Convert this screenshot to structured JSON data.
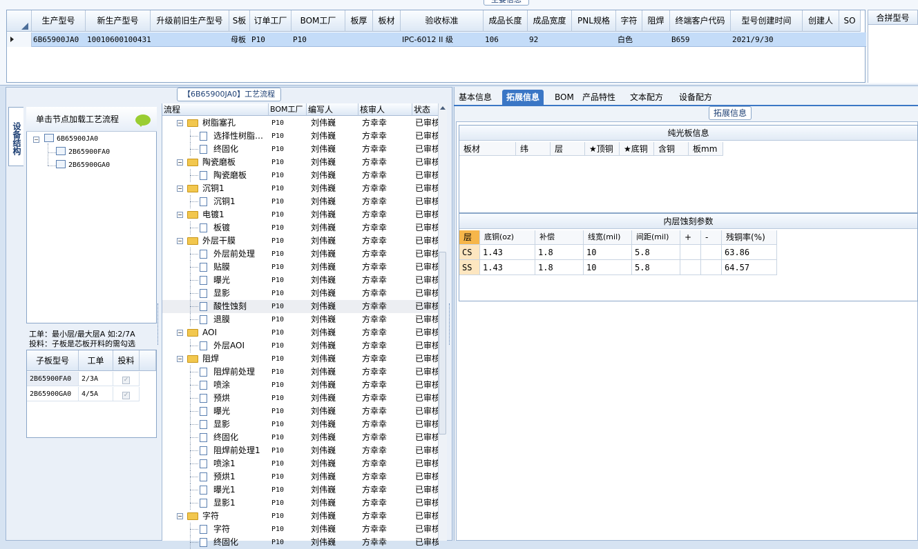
{
  "main_info": {
    "title": "主要信息",
    "columns": [
      "生产型号",
      "新生产型号",
      "升级前旧生产型号",
      "S板",
      "订单工厂",
      "BOM工厂",
      "板厚",
      "板材",
      "验收标准",
      "成品长度",
      "成品宽度",
      "PNL规格",
      "字符",
      "阻焊",
      "终端客户代码",
      "型号创建时间",
      "创建人",
      "SO"
    ],
    "row": {
      "prod_model": "6B65900JA0",
      "new_model": "10010600100431",
      "old_model": "",
      "s_board": "母板",
      "order_factory": "P10",
      "bom_factory": "P10",
      "thickness": "",
      "material": "",
      "standard": "IPC-6012 II 级",
      "length": "106",
      "width": "92",
      "pnl": "",
      "char": "白色",
      "solder": "",
      "client_code": "B659",
      "created": "2021/9/30",
      "creator": "",
      "so": ""
    },
    "merge_header": "合拼型号"
  },
  "process": {
    "title": "【6B65900JA0】工艺流程",
    "side_tab": "设备结构",
    "tree_hint": "单击节点加载工艺流程",
    "tree": {
      "root": "6B65900JA0",
      "children": [
        "2B65900FA0",
        "2B65900GA0"
      ]
    },
    "note1": "工单：最小层/最大层A 如:2/7A",
    "note2": "投料：子板是芯板开料的需勾选",
    "sub_headers": [
      "子板型号",
      "工单",
      "投料"
    ],
    "sub_rows": [
      {
        "model": "2B65900FA0",
        "order": "2/3A",
        "checked": "✓"
      },
      {
        "model": "2B65900GA0",
        "order": "4/5A",
        "checked": "✓"
      }
    ],
    "grid_headers": [
      "流程",
      "BOM工厂",
      "编写人",
      "核审人",
      "状态"
    ],
    "rows": [
      {
        "name": "树脂塞孔",
        "type": "folder",
        "factory": "P10",
        "writer": "刘伟巍",
        "reviewer": "方幸幸",
        "status": "已审核"
      },
      {
        "name": "选择性树脂…",
        "type": "doc",
        "factory": "P10",
        "writer": "刘伟巍",
        "reviewer": "方幸幸",
        "status": "已审核"
      },
      {
        "name": "终固化",
        "type": "doc",
        "factory": "P10",
        "writer": "刘伟巍",
        "reviewer": "方幸幸",
        "status": "已审核"
      },
      {
        "name": "陶瓷磨板",
        "type": "folder",
        "factory": "P10",
        "writer": "刘伟巍",
        "reviewer": "方幸幸",
        "status": "已审核"
      },
      {
        "name": "陶瓷磨板",
        "type": "doc",
        "factory": "P10",
        "writer": "刘伟巍",
        "reviewer": "方幸幸",
        "status": "已审核"
      },
      {
        "name": "沉铜1",
        "type": "folder",
        "factory": "P10",
        "writer": "刘伟巍",
        "reviewer": "方幸幸",
        "status": "已审核"
      },
      {
        "name": "沉铜1",
        "type": "doc",
        "factory": "P10",
        "writer": "刘伟巍",
        "reviewer": "方幸幸",
        "status": "已审核"
      },
      {
        "name": "电镀1",
        "type": "folder",
        "factory": "P10",
        "writer": "刘伟巍",
        "reviewer": "方幸幸",
        "status": "已审核"
      },
      {
        "name": "板镀",
        "type": "doc",
        "factory": "P10",
        "writer": "刘伟巍",
        "reviewer": "方幸幸",
        "status": "已审核"
      },
      {
        "name": "外层干膜",
        "type": "folder",
        "factory": "P10",
        "writer": "刘伟巍",
        "reviewer": "方幸幸",
        "status": "已审核"
      },
      {
        "name": "外层前处理",
        "type": "doc",
        "factory": "P10",
        "writer": "刘伟巍",
        "reviewer": "方幸幸",
        "status": "已审核"
      },
      {
        "name": "贴膜",
        "type": "doc",
        "factory": "P10",
        "writer": "刘伟巍",
        "reviewer": "方幸幸",
        "status": "已审核"
      },
      {
        "name": "曝光",
        "type": "doc",
        "factory": "P10",
        "writer": "刘伟巍",
        "reviewer": "方幸幸",
        "status": "已审核"
      },
      {
        "name": "显影",
        "type": "doc",
        "factory": "P10",
        "writer": "刘伟巍",
        "reviewer": "方幸幸",
        "status": "已审核"
      },
      {
        "name": "酸性蚀刻",
        "type": "doc",
        "factory": "P10",
        "writer": "刘伟巍",
        "reviewer": "方幸幸",
        "status": "已审核",
        "selected": true
      },
      {
        "name": "退膜",
        "type": "doc",
        "factory": "P10",
        "writer": "刘伟巍",
        "reviewer": "方幸幸",
        "status": "已审核"
      },
      {
        "name": "AOI",
        "type": "folder",
        "factory": "P10",
        "writer": "刘伟巍",
        "reviewer": "方幸幸",
        "status": "已审核"
      },
      {
        "name": "外层AOI",
        "type": "doc",
        "factory": "P10",
        "writer": "刘伟巍",
        "reviewer": "方幸幸",
        "status": "已审核"
      },
      {
        "name": "阻焊",
        "type": "folder",
        "factory": "P10",
        "writer": "刘伟巍",
        "reviewer": "方幸幸",
        "status": "已审核"
      },
      {
        "name": "阻焊前处理",
        "type": "doc",
        "factory": "P10",
        "writer": "刘伟巍",
        "reviewer": "方幸幸",
        "status": "已审核"
      },
      {
        "name": "喷涂",
        "type": "doc",
        "factory": "P10",
        "writer": "刘伟巍",
        "reviewer": "方幸幸",
        "status": "已审核"
      },
      {
        "name": "预烘",
        "type": "doc",
        "factory": "P10",
        "writer": "刘伟巍",
        "reviewer": "方幸幸",
        "status": "已审核"
      },
      {
        "name": "曝光",
        "type": "doc",
        "factory": "P10",
        "writer": "刘伟巍",
        "reviewer": "方幸幸",
        "status": "已审核"
      },
      {
        "name": "显影",
        "type": "doc",
        "factory": "P10",
        "writer": "刘伟巍",
        "reviewer": "方幸幸",
        "status": "已审核"
      },
      {
        "name": "终固化",
        "type": "doc",
        "factory": "P10",
        "writer": "刘伟巍",
        "reviewer": "方幸幸",
        "status": "已审核"
      },
      {
        "name": "阻焊前处理1",
        "type": "doc",
        "factory": "P10",
        "writer": "刘伟巍",
        "reviewer": "方幸幸",
        "status": "已审核"
      },
      {
        "name": "喷涂1",
        "type": "doc",
        "factory": "P10",
        "writer": "刘伟巍",
        "reviewer": "方幸幸",
        "status": "已审核"
      },
      {
        "name": "预烘1",
        "type": "doc",
        "factory": "P10",
        "writer": "刘伟巍",
        "reviewer": "方幸幸",
        "status": "已审核"
      },
      {
        "name": "曝光1",
        "type": "doc",
        "factory": "P10",
        "writer": "刘伟巍",
        "reviewer": "方幸幸",
        "status": "已审核"
      },
      {
        "name": "显影1",
        "type": "doc",
        "factory": "P10",
        "writer": "刘伟巍",
        "reviewer": "方幸幸",
        "status": "已审核"
      },
      {
        "name": "字符",
        "type": "folder",
        "factory": "P10",
        "writer": "刘伟巍",
        "reviewer": "方幸幸",
        "status": "已审核"
      },
      {
        "name": "字符",
        "type": "doc",
        "factory": "P10",
        "writer": "刘伟巍",
        "reviewer": "方幸幸",
        "status": "已审核"
      },
      {
        "name": "终固化",
        "type": "doc",
        "factory": "P10",
        "writer": "刘伟巍",
        "reviewer": "方幸幸",
        "status": "已审核"
      }
    ]
  },
  "tabs": [
    "基本信息",
    "拓展信息",
    "BOM",
    "产品特性",
    "文本配方",
    "设备配方"
  ],
  "active_tab": 1,
  "ext": {
    "title": "拓展信息",
    "plain_title": "纯光板信息",
    "plain_headers": [
      "板材",
      "纬",
      "层",
      "★顶铜",
      "★底铜",
      "含铜",
      "板mm"
    ],
    "etch_title": "内层蚀刻参数",
    "etch_headers": [
      "层",
      "底铜(oz)",
      "补偿",
      "线宽(mil)",
      "间距(mil)",
      "+",
      "-",
      "残铜率(%)"
    ],
    "etch_rows": [
      [
        "CS",
        "1.43",
        "1.8",
        "10",
        "5.8",
        "",
        "",
        "63.86"
      ],
      [
        "SS",
        "1.43",
        "1.8",
        "10",
        "5.8",
        "",
        "",
        "64.57"
      ]
    ]
  },
  "colors": {
    "accent": "#3a76c5",
    "selected_row": "#c4dcf8",
    "layer_header": "#f6b64a"
  }
}
